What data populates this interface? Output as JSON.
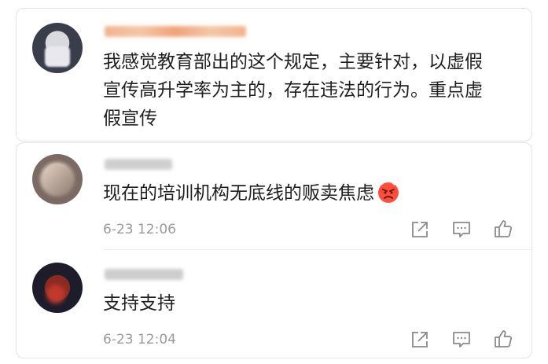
{
  "comments": [
    {
      "text_lines": [
        "我感觉教育部出的这个规定，主要针对，以虚假",
        "宣传高升学率为主的，存在违法的行为。重点虚",
        "假宣传"
      ]
    },
    {
      "text": "现在的培训机构无底线的贩卖焦虑",
      "emoji": "angry-face-icon",
      "time": "6-23 12:06"
    },
    {
      "text": "支持支持",
      "time": "6-23 12:04"
    }
  ],
  "colors": {
    "text": "#1f1f1f",
    "meta": "#9b9b9b",
    "username_orange": "#f0a37a",
    "username_gray": "#c8c8c8"
  }
}
